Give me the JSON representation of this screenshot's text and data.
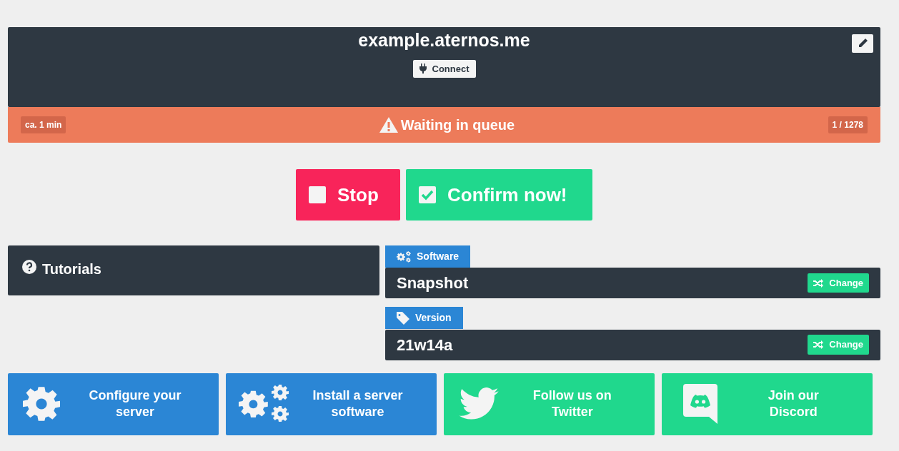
{
  "server": {
    "address": "example.aternos.me",
    "connect_label": "Connect"
  },
  "status": {
    "eta": "ca. 1 min",
    "label": "Waiting in queue",
    "position": "1 / 1278"
  },
  "actions": [
    {
      "label": "Stop",
      "kind": "stop"
    },
    {
      "label": "Confirm now!",
      "kind": "confirm"
    }
  ],
  "tutorials": {
    "title": "Tutorials"
  },
  "settings": [
    {
      "tab": "Software",
      "value": "Snapshot",
      "button": "Change"
    },
    {
      "tab": "Version",
      "value": "21w14a",
      "button": "Change"
    }
  ],
  "tiles": [
    {
      "label": "Configure your server",
      "color": "#2b86d5"
    },
    {
      "label": "Install a server software",
      "color": "#2b86d5"
    },
    {
      "label": "Follow us on Twitter",
      "color": "#20d88d"
    },
    {
      "label": "Join our Discord",
      "color": "#20d88d"
    }
  ]
}
